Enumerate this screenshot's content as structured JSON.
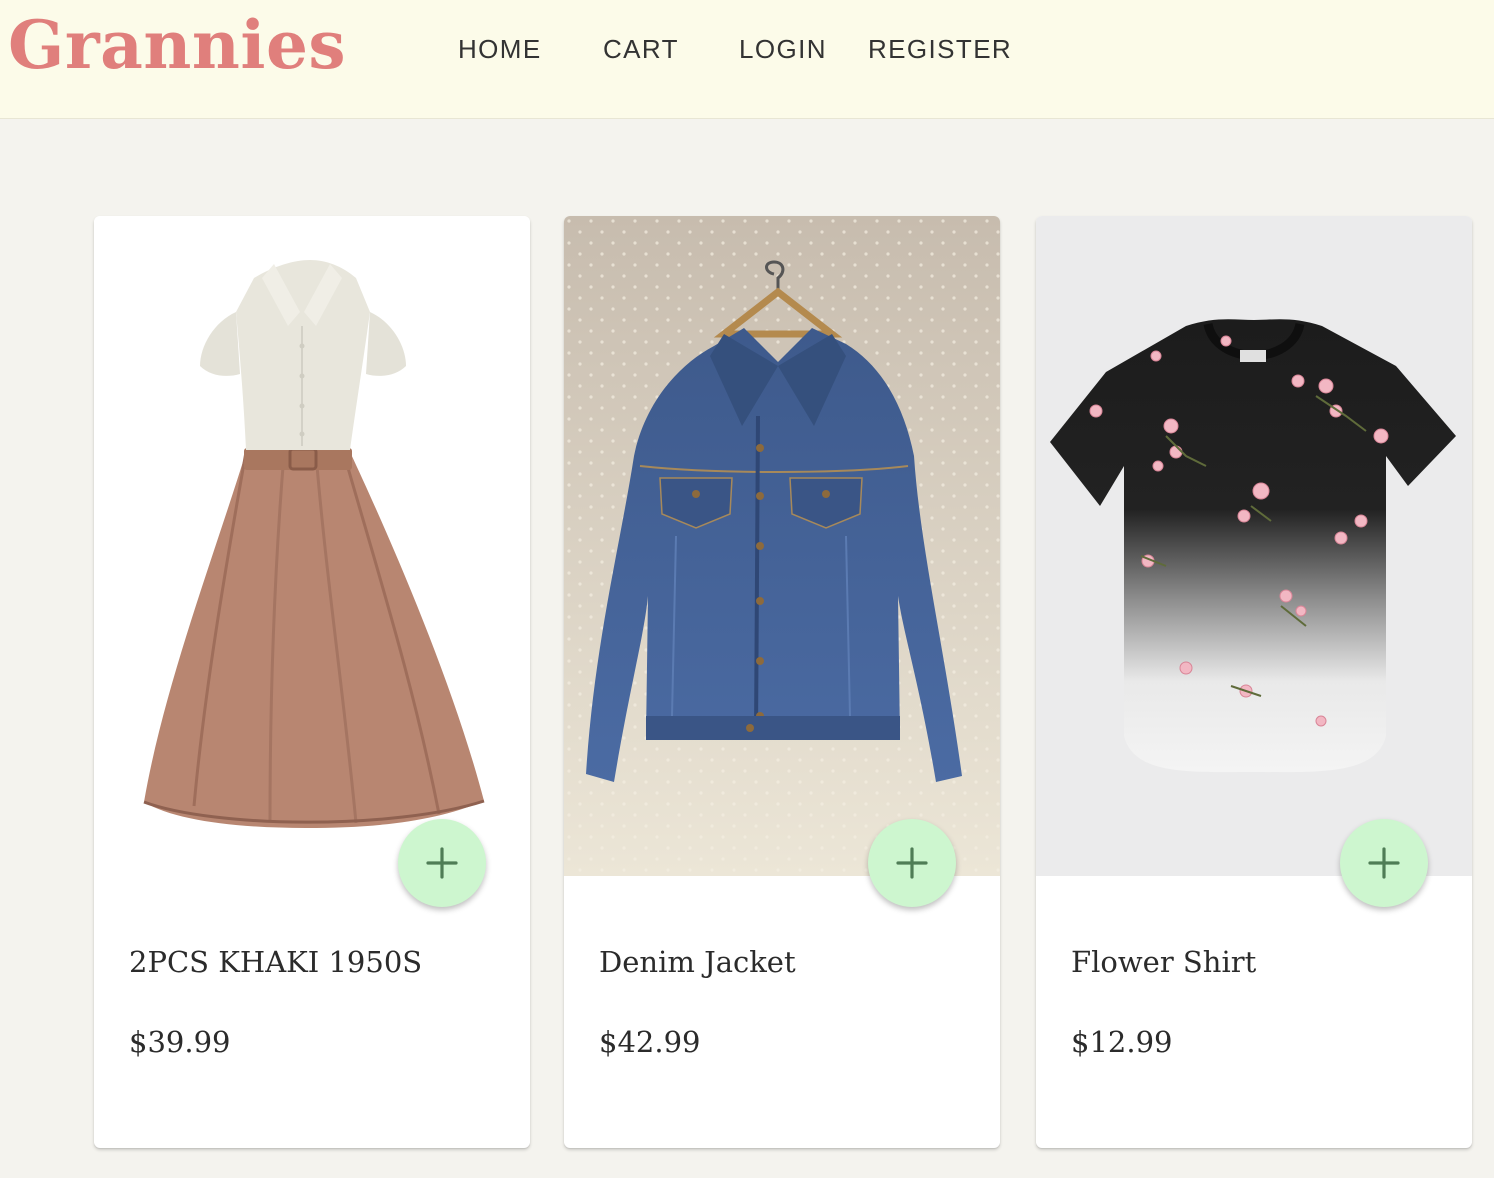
{
  "brand": {
    "name": "Grannies",
    "color": "#e07f7c"
  },
  "nav": {
    "items": [
      "HOME",
      "CART",
      "LOGIN",
      "REGISTER"
    ]
  },
  "colors": {
    "header_bg": "#fcfbe9",
    "page_bg": "#f4f3ee",
    "add_button_bg": "#cdf6cf",
    "add_icon": "#4f7d56"
  },
  "products": [
    {
      "title": "2PCS KHAKI 1950S",
      "price": "$39.99",
      "image": "vintage-dress-image",
      "add_icon": "plus-icon"
    },
    {
      "title": "Denim Jacket",
      "price": "$42.99",
      "image": "denim-jacket-image",
      "add_icon": "plus-icon"
    },
    {
      "title": "Flower Shirt",
      "price": "$12.99",
      "image": "flower-shirt-image",
      "add_icon": "plus-icon"
    }
  ]
}
